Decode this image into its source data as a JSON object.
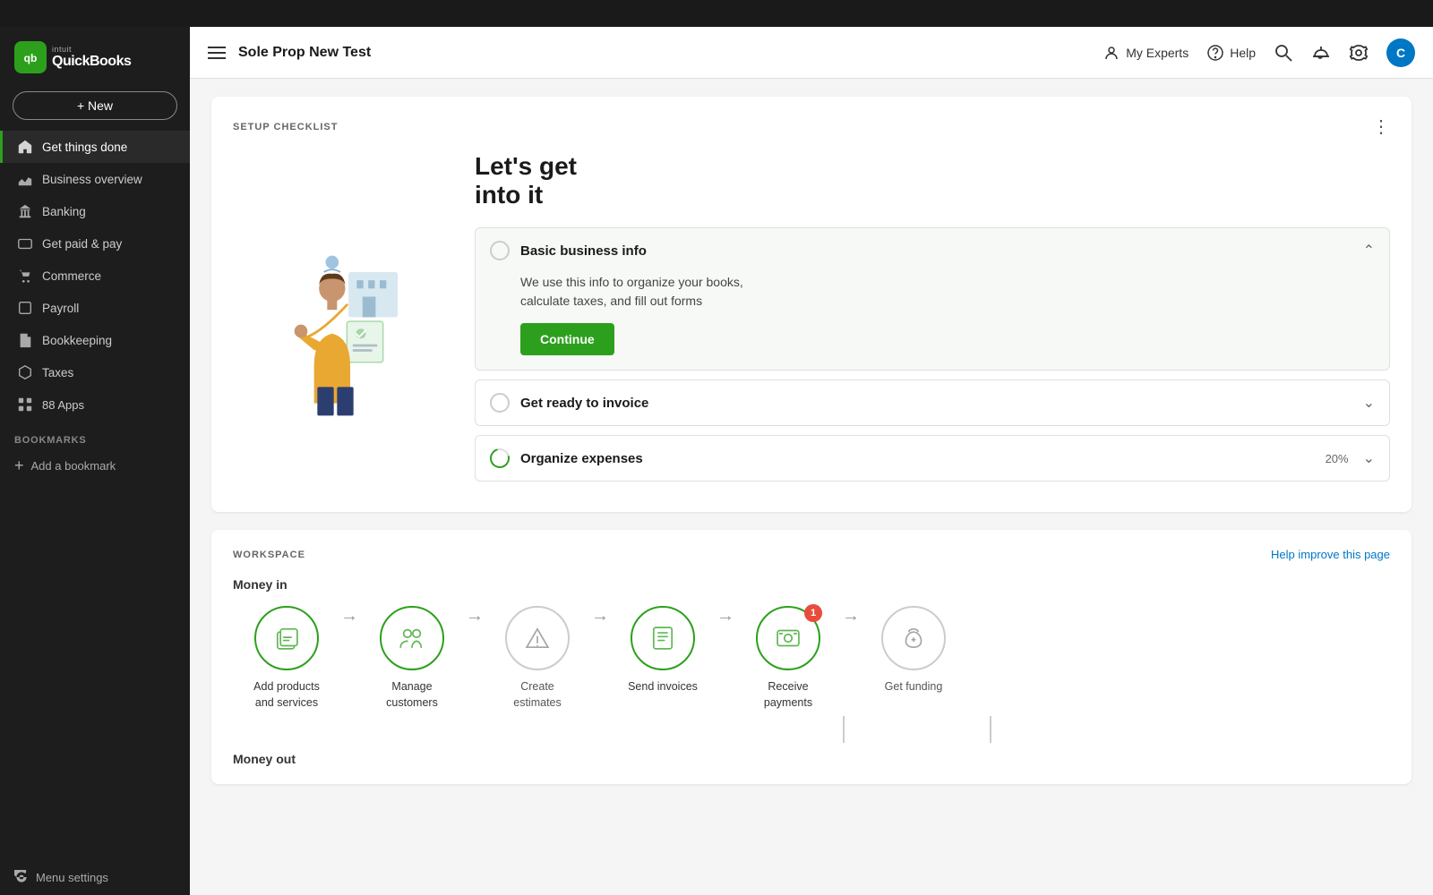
{
  "topBar": {},
  "sidebar": {
    "logoAlt": "QuickBooks",
    "logoLetter": "qb",
    "newButton": "+ New",
    "navItems": [
      {
        "id": "get-things-done",
        "label": "Get things done",
        "icon": "home",
        "active": true
      },
      {
        "id": "business-overview",
        "label": "Business overview",
        "icon": "chart"
      },
      {
        "id": "banking",
        "label": "Banking",
        "icon": "bank"
      },
      {
        "id": "get-paid-pay",
        "label": "Get paid & pay",
        "icon": "pay"
      },
      {
        "id": "commerce",
        "label": "Commerce",
        "icon": "commerce"
      },
      {
        "id": "payroll",
        "label": "Payroll",
        "icon": "payroll"
      },
      {
        "id": "bookkeeping",
        "label": "Bookkeeping",
        "icon": "bookkeeping"
      },
      {
        "id": "taxes",
        "label": "Taxes",
        "icon": "taxes"
      },
      {
        "id": "apps",
        "label": "Apps",
        "icon": "apps"
      },
      {
        "id": "apps-count",
        "label": "88 Apps",
        "icon": "apps2"
      }
    ],
    "bookmarksTitle": "BOOKMARKS",
    "addBookmark": "Add a bookmark",
    "menuSettings": "Menu settings"
  },
  "header": {
    "title": "Sole Prop New Test",
    "myExperts": "My Experts",
    "help": "Help",
    "userInitial": "C"
  },
  "setupChecklist": {
    "sectionLabel": "SETUP CHECKLIST",
    "heading": "Let's get\ninto it",
    "items": [
      {
        "id": "basic-info",
        "title": "Basic business info",
        "expanded": true,
        "description": "We use this info to organize your books,\ncalculate taxes, and fill out forms",
        "actionLabel": "Continue"
      },
      {
        "id": "get-ready-invoice",
        "title": "Get ready to invoice",
        "expanded": false
      },
      {
        "id": "organize-expenses",
        "title": "Organize expenses",
        "expanded": false,
        "progress": "20%"
      }
    ]
  },
  "workspace": {
    "sectionLabel": "WORKSPACE",
    "helpImprove": "Help improve this page",
    "moneyInTitle": "Money in",
    "moneyOutTitle": "Money out",
    "workflowItems": [
      {
        "id": "add-products",
        "label": "Add products\nand services",
        "icon": "invoice-stack",
        "active": true,
        "badge": null
      },
      {
        "id": "manage-customers",
        "label": "Manage\ncustomers",
        "icon": "users",
        "active": true,
        "badge": null
      },
      {
        "id": "create-estimates",
        "label": "Create\nestimates",
        "icon": "warning-triangle",
        "active": false,
        "badge": null
      },
      {
        "id": "send-invoices",
        "label": "Send invoices",
        "icon": "invoice-doc",
        "active": true,
        "badge": null
      },
      {
        "id": "receive-payments",
        "label": "Receive\npayments",
        "icon": "payment",
        "active": true,
        "badge": 1
      },
      {
        "id": "get-funding",
        "label": "Get funding",
        "icon": "money-bag",
        "active": false,
        "badge": null
      }
    ]
  }
}
